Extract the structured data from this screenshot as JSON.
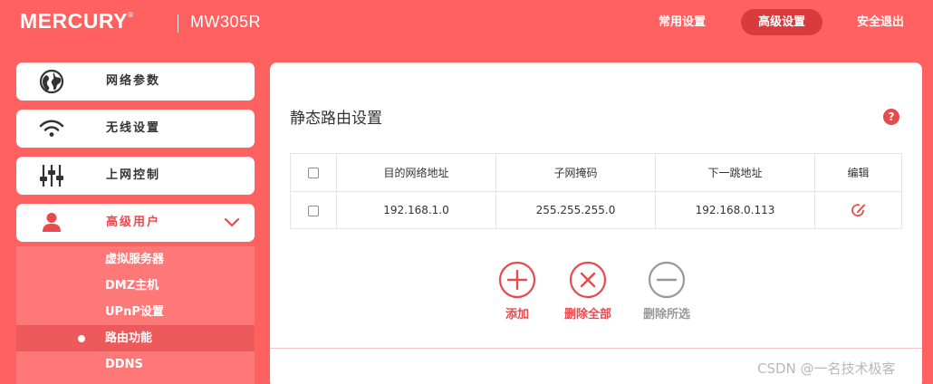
{
  "header": {
    "brand": "MERCURY",
    "brand_mark": "®",
    "model": "MW305R",
    "nav": {
      "common": "常用设置",
      "advanced": "高级设置",
      "logout": "安全退出"
    }
  },
  "sidebar": {
    "items": [
      {
        "label": "网络参数",
        "icon": "globe-icon"
      },
      {
        "label": "无线设置",
        "icon": "wifi-icon"
      },
      {
        "label": "上网控制",
        "icon": "sliders-icon"
      },
      {
        "label": "高级用户",
        "icon": "user-icon"
      }
    ],
    "submenu": [
      {
        "label": "虚拟服务器"
      },
      {
        "label": "DMZ主机"
      },
      {
        "label": "UPnP设置"
      },
      {
        "label": "路由功能"
      },
      {
        "label": "DDNS"
      }
    ]
  },
  "main": {
    "title": "静态路由设置",
    "help": "?",
    "table": {
      "headers": [
        "目的网络地址",
        "子网掩码",
        "下一跳地址",
        "编辑"
      ],
      "rows": [
        {
          "destination": "192.168.1.0",
          "mask": "255.255.255.0",
          "next_hop": "192.168.0.113"
        }
      ]
    },
    "actions": {
      "add": "添加",
      "delete_all": "删除全部",
      "delete_selected": "删除所选"
    }
  },
  "watermark": "CSDN @一名技术极客",
  "colors": {
    "brand_red": "#ff6060",
    "active_red": "#e84a4d",
    "disabled_gray": "#999999"
  }
}
